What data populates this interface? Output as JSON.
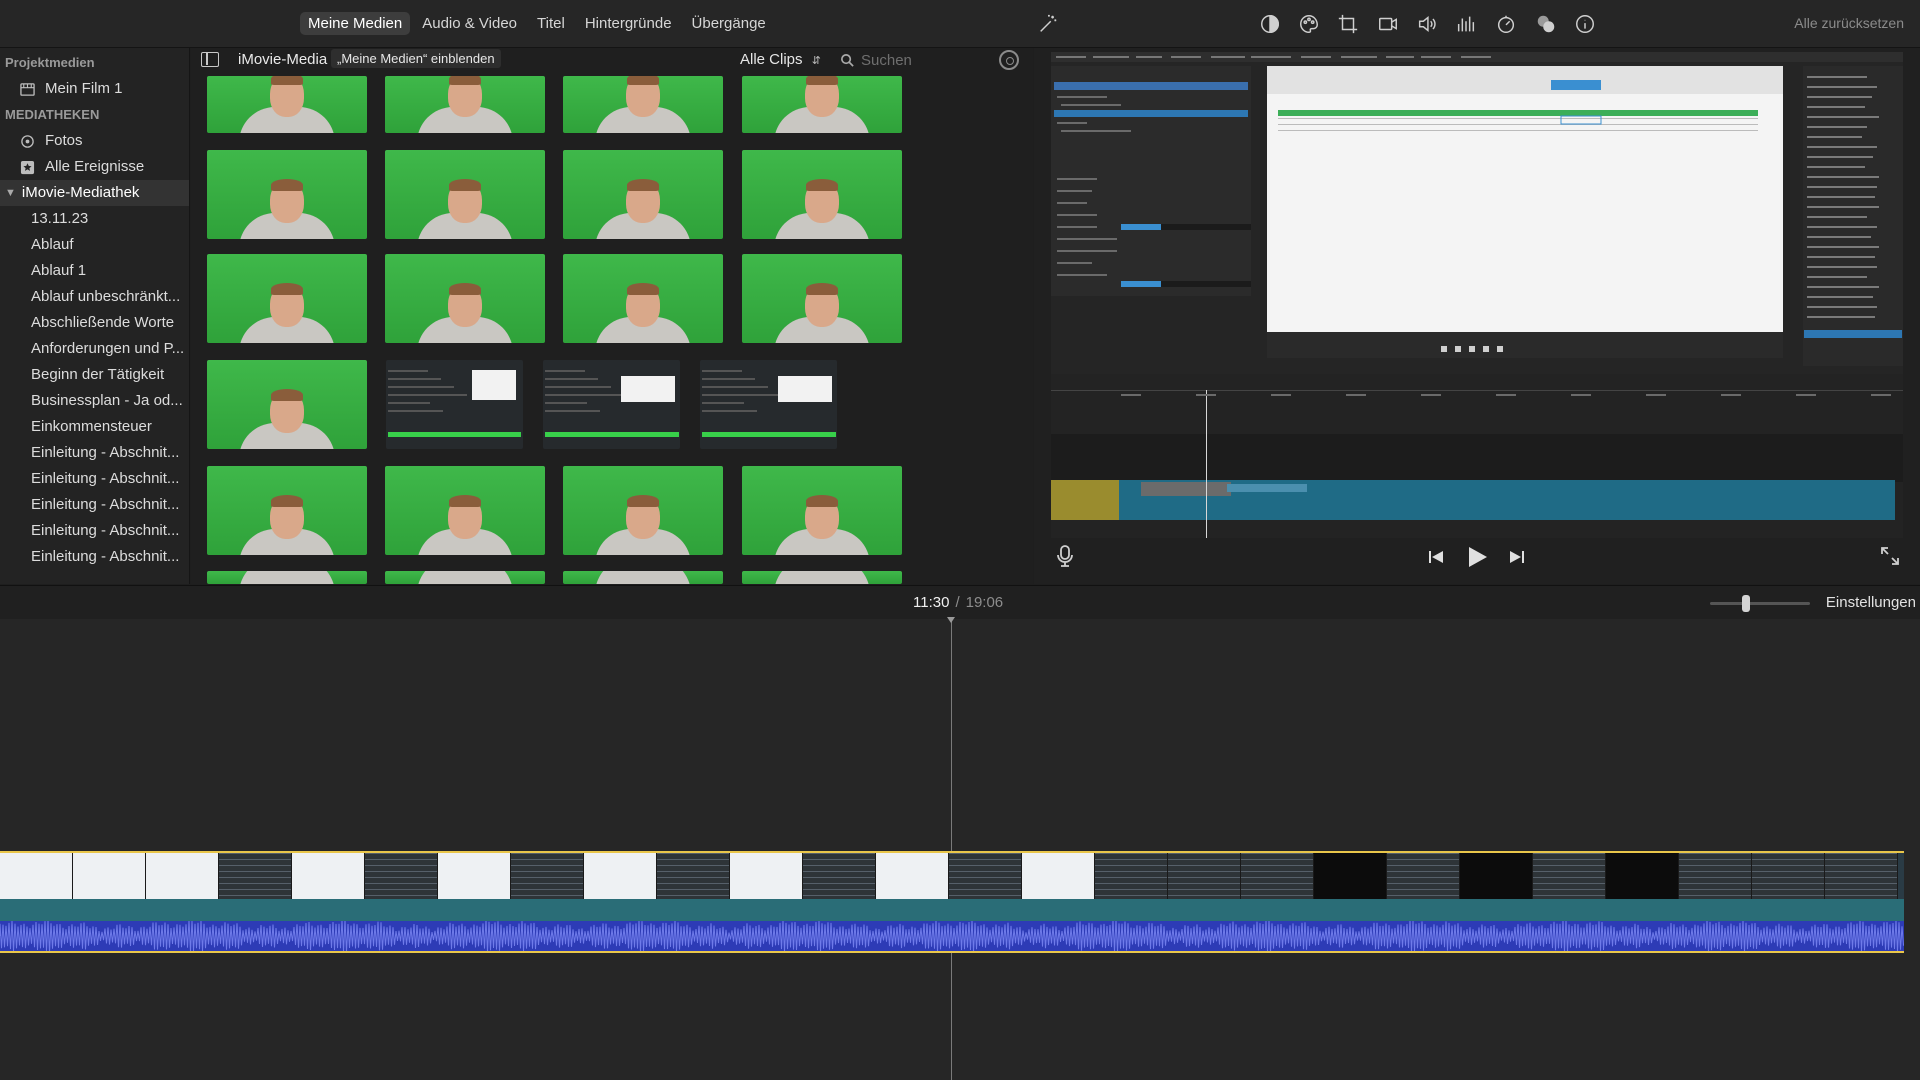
{
  "toolbar": {
    "tabs": [
      "Meine Medien",
      "Audio & Video",
      "Titel",
      "Hintergründe",
      "Übergänge"
    ],
    "active_tab": "Meine Medien",
    "icons": [
      "magic-wand-icon",
      "color-balance-icon",
      "color-palette-icon",
      "crop-icon",
      "stabilization-icon",
      "volume-icon",
      "equalizer-icon",
      "speed-icon",
      "overlay-icon",
      "info-icon"
    ],
    "reset_all": "Alle zurücksetzen"
  },
  "sidebar": {
    "project_heading": "Projektmedien",
    "project_item": "Mein Film 1",
    "libraries_heading": "MEDIATHEKEN",
    "top_items": [
      "Fotos",
      "Alle Ereignisse"
    ],
    "library": "iMovie-Mediathek",
    "events": [
      "13.11.23",
      "Ablauf",
      "Ablauf 1",
      "Ablauf unbeschränkt...",
      "Abschließende Worte",
      "Anforderungen und P...",
      "Beginn der Tätigkeit",
      "Businessplan - Ja od...",
      "Einkommensteuer",
      "Einleitung - Abschnit...",
      "Einleitung - Abschnit...",
      "Einleitung - Abschnit...",
      "Einleitung - Abschnit...",
      "Einleitung - Abschnit..."
    ]
  },
  "browser": {
    "library_title": "iMovie-Media",
    "tooltip": "„Meine Medien“ einblenden",
    "filter": "Alle Clips",
    "search_placeholder": "Suchen"
  },
  "timeline": {
    "current_time": "11:30",
    "separator": "/",
    "total_time": "19:06",
    "settings": "Einstellungen"
  },
  "colors": {
    "accent_yellow": "#e9c64a",
    "greenscreen": "#36ad42",
    "audio_track": "#2d3bb6",
    "video_lower": "#2a6d77"
  }
}
